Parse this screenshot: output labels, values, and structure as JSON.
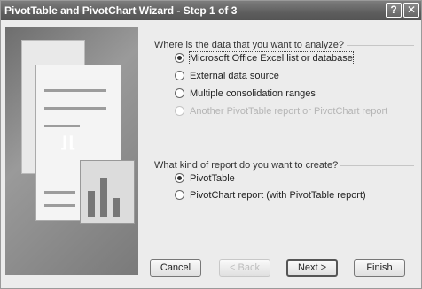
{
  "window": {
    "title": "PivotTable and PivotChart Wizard - Step 1 of 3",
    "help_symbol": "?",
    "close_symbol": "✕"
  },
  "source_group": {
    "prompt": "Where is the data that you want to analyze?",
    "options": [
      {
        "label": "Microsoft Office Excel list or database",
        "selected": true
      },
      {
        "label": "External data source",
        "selected": false
      },
      {
        "label": "Multiple consolidation ranges",
        "selected": false
      },
      {
        "label": "Another PivotTable report or PivotChart report",
        "selected": false,
        "disabled": true
      }
    ]
  },
  "report_group": {
    "prompt": "What kind of report do you want to create?",
    "options": [
      {
        "label": "PivotTable",
        "selected": true
      },
      {
        "label": "PivotChart report (with PivotTable report)",
        "selected": false
      }
    ]
  },
  "buttons": {
    "cancel": "Cancel",
    "back": "< Back",
    "next": "Next >",
    "finish": "Finish"
  },
  "icons": [
    "help-icon",
    "close-icon"
  ]
}
